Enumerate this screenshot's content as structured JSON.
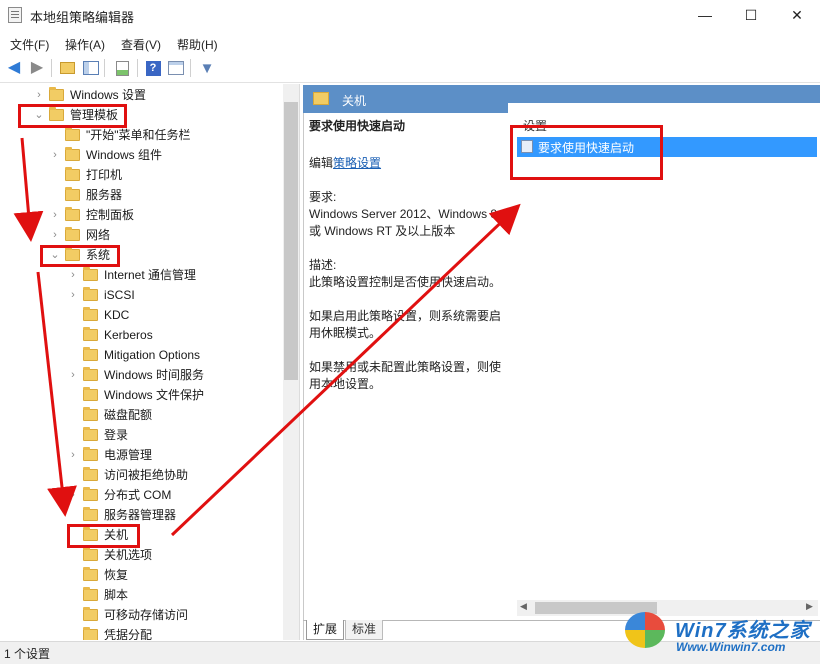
{
  "window": {
    "title": "本地组策略编辑器",
    "controls": {
      "minimize": "—",
      "maximize": "☐",
      "close": "✕"
    }
  },
  "menu": [
    "文件(F)",
    "操作(A)",
    "查看(V)",
    "帮助(H)"
  ],
  "toolbar": [
    "back-icon",
    "forward-icon",
    "up-folder-icon",
    "show-hide-tree-icon",
    "export-list-icon",
    "help-icon",
    "properties-icon",
    "filter-icon"
  ],
  "tree": {
    "items": [
      {
        "label": "Windows 设置",
        "indent": 0,
        "arrow": "›"
      },
      {
        "label": "管理模板",
        "indent": 0,
        "arrow": "⌄"
      },
      {
        "label": "\"开始\"菜单和任务栏",
        "indent": 1,
        "arrow": ""
      },
      {
        "label": "Windows 组件",
        "indent": 1,
        "arrow": "›"
      },
      {
        "label": "打印机",
        "indent": 1,
        "arrow": ""
      },
      {
        "label": "服务器",
        "indent": 1,
        "arrow": ""
      },
      {
        "label": "控制面板",
        "indent": 1,
        "arrow": "›"
      },
      {
        "label": "网络",
        "indent": 1,
        "arrow": "›"
      },
      {
        "label": "系统",
        "indent": 1,
        "arrow": "⌄"
      },
      {
        "label": "Internet 通信管理",
        "indent": 2,
        "arrow": "›"
      },
      {
        "label": "iSCSI",
        "indent": 2,
        "arrow": "›"
      },
      {
        "label": "KDC",
        "indent": 2,
        "arrow": ""
      },
      {
        "label": "Kerberos",
        "indent": 2,
        "arrow": ""
      },
      {
        "label": "Mitigation Options",
        "indent": 2,
        "arrow": ""
      },
      {
        "label": "Windows 时间服务",
        "indent": 2,
        "arrow": "›"
      },
      {
        "label": "Windows 文件保护",
        "indent": 2,
        "arrow": ""
      },
      {
        "label": "磁盘配额",
        "indent": 2,
        "arrow": ""
      },
      {
        "label": "登录",
        "indent": 2,
        "arrow": ""
      },
      {
        "label": "电源管理",
        "indent": 2,
        "arrow": "›"
      },
      {
        "label": "访问被拒绝协助",
        "indent": 2,
        "arrow": ""
      },
      {
        "label": "分布式 COM",
        "indent": 2,
        "arrow": "›"
      },
      {
        "label": "服务器管理器",
        "indent": 2,
        "arrow": ""
      },
      {
        "label": "关机",
        "indent": 2,
        "arrow": ""
      },
      {
        "label": "关机选项",
        "indent": 2,
        "arrow": ""
      },
      {
        "label": "恢复",
        "indent": 2,
        "arrow": ""
      },
      {
        "label": "脚本",
        "indent": 2,
        "arrow": ""
      },
      {
        "label": "可移动存储访问",
        "indent": 2,
        "arrow": ""
      },
      {
        "label": "凭据分配",
        "indent": 2,
        "arrow": ""
      }
    ]
  },
  "right": {
    "header_title": "关机",
    "policy_title": "要求使用快速启动",
    "edit_prefix": "编辑",
    "edit_link": "策略设置",
    "req_label": "要求:",
    "req_text": "Windows Server 2012、Windows 8 或 Windows RT 及以上版本",
    "desc_label": "描述:",
    "desc_text": "此策略设置控制是否使用快速启动。",
    "enable_text": "如果启用此策略设置，则系统需要启用休眠模式。",
    "disable_text": "如果禁用或未配置此策略设置，则使用本地设置。",
    "list_header": "设置",
    "list_item": "要求使用快速启动",
    "tabs": [
      "扩展",
      "标准"
    ]
  },
  "status": {
    "text": "1 个设置"
  },
  "watermark": {
    "title": "Win7系统之家",
    "url": "Www.Winwin7.com"
  },
  "annotation": {
    "color": "#e01010"
  }
}
